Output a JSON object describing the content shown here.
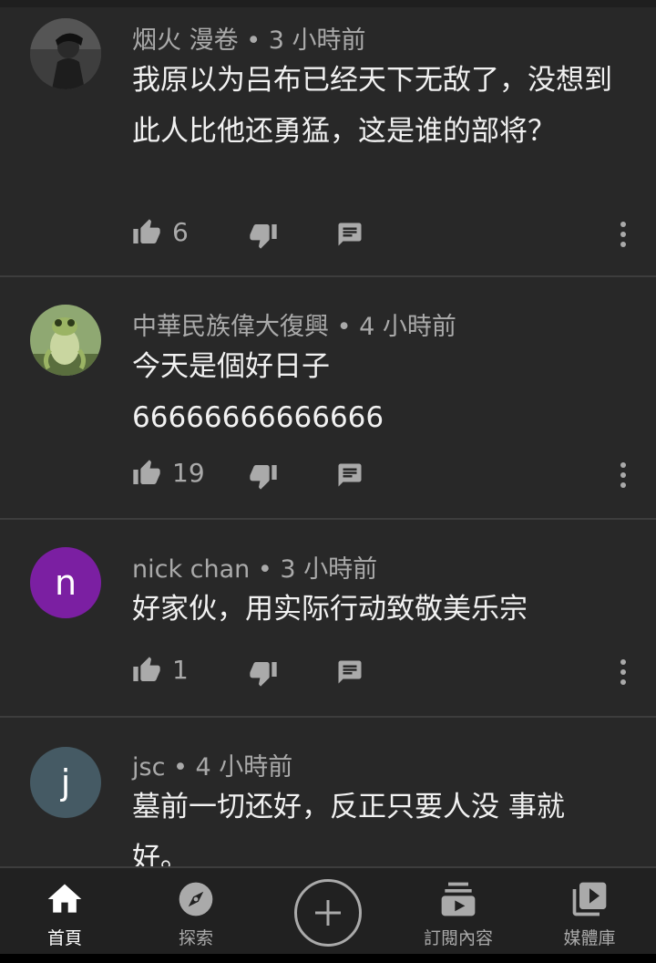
{
  "comments": [
    {
      "author": "烟火 漫卷",
      "time": "3 小時前",
      "text": "我原以为吕布已经天下无敌了，没想到此人比他还勇猛，这是谁的部将？",
      "likes": "6",
      "avatar": {
        "type": "photo",
        "colors": [
          "#3a3a3a",
          "#5c5c5c"
        ],
        "icon": "person-photo-icon"
      }
    },
    {
      "author": "中華民族偉大復興",
      "time": "4 小時前",
      "text_lines": [
        "今天是個好日子",
        "66666666666666"
      ],
      "likes": "19",
      "avatar": {
        "type": "photo",
        "colors": [
          "#6b8a4e",
          "#b7c38f"
        ],
        "icon": "frog-photo-icon"
      }
    },
    {
      "author": "nick chan",
      "time": "3 小時前",
      "text": "好家伙，用实际行动致敬美乐宗",
      "likes": "1",
      "avatar": {
        "type": "letter",
        "letter": "n",
        "color": "#7b1fa2"
      }
    },
    {
      "author": "jsc",
      "time": "4 小時前",
      "text": "墓前一切还好，反正只要人没 事就好。",
      "avatar": {
        "type": "letter",
        "letter": "j",
        "color": "#455a64"
      }
    }
  ],
  "separator": "•",
  "nav": {
    "home": "首頁",
    "explore": "探索",
    "subscriptions": "訂閱內容",
    "library": "媒體庫"
  }
}
